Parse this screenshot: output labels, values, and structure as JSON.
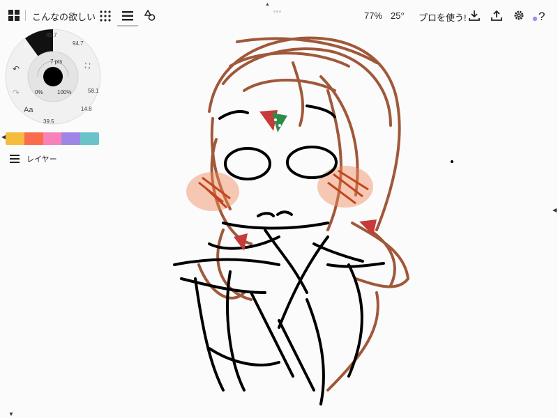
{
  "topbar": {
    "doc_title": "こんなの欲しい",
    "zoom": "77%",
    "rotation": "25°",
    "pro_label": "プロを使う!",
    "icons": [
      "gallery-grid-icon",
      "dot-grid-icon",
      "layers-menu-icon",
      "shapes-icon",
      "download-icon",
      "share-icon",
      "settings-icon",
      "help-icon"
    ]
  },
  "wheel": {
    "size_label": "7 pts",
    "opacity_label": "0%",
    "percent_label": "100%",
    "tool_values": [
      "7",
      "45.7",
      "94.7",
      "58.1",
      "14.8",
      "39.5"
    ],
    "text_tool": "Aa"
  },
  "palette": {
    "colors": [
      "#f5bc3e",
      "#f96d4d",
      "#f682b8",
      "#9e86e6",
      "#69c3c9"
    ]
  },
  "layers": {
    "label": "レイヤー"
  },
  "accent": {
    "help_dot": "#a58cf0"
  }
}
